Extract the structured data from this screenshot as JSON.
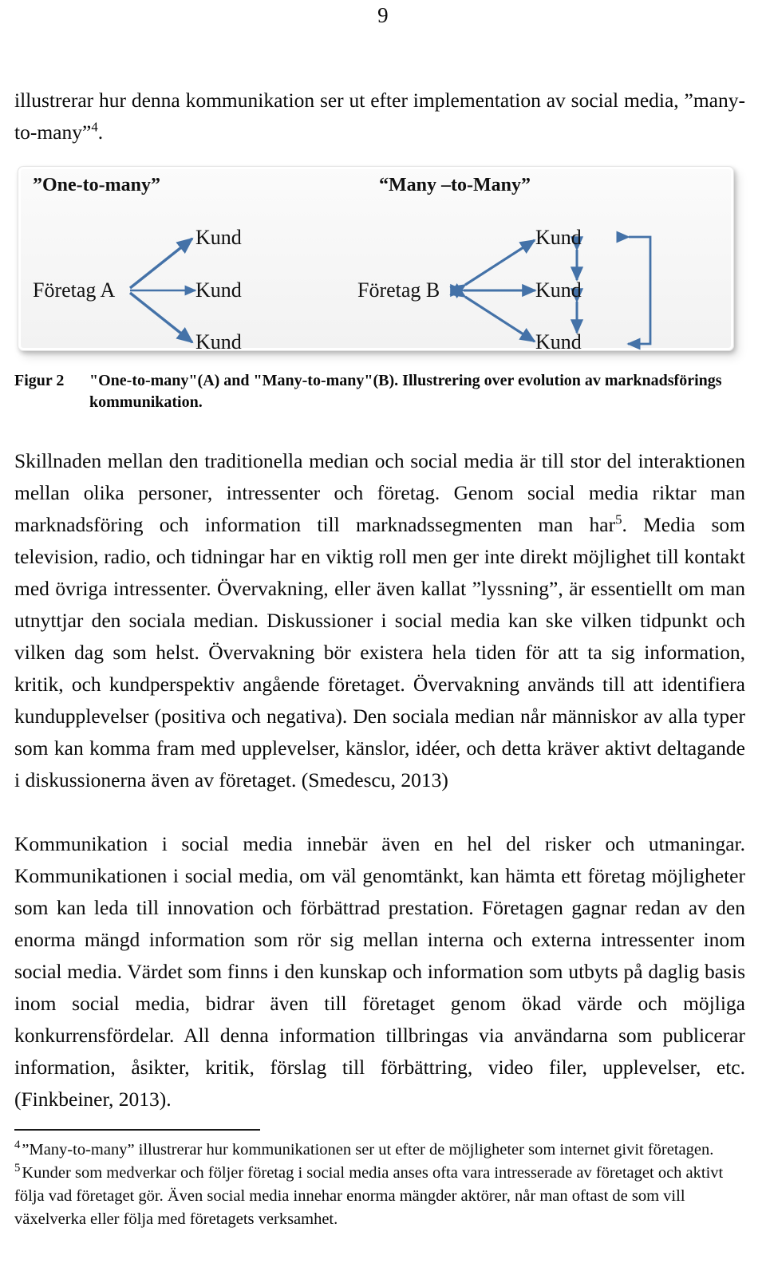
{
  "page": {
    "number": "9"
  },
  "body": {
    "paragraph_1": "illustrerar hur denna kommunikation ser ut efter implementation av social media, ”many-to-many”",
    "paragraph_1_footnote_ref": "4",
    "paragraph_1_tail": ".",
    "paragraph_2_a": "Skillnaden mellan den traditionella median och social media är till stor del interaktionen mellan olika personer, intressenter och företag. Genom social media riktar man marknadsföring och information till marknadssegmenten man har",
    "paragraph_2_footnote_ref": "5",
    "paragraph_2_b": ". Media som television, radio, och tidningar har en viktig roll men ger inte direkt möjlighet till kontakt med övriga intressenter. Övervakning, eller även kallat ”lyssning”, är essentiellt om man utnyttjar den sociala median. Diskussioner i social media kan ske vilken tidpunkt och vilken dag som helst. Övervakning bör existera hela tiden för att ta sig information, kritik, och kundperspektiv angående företaget. Övervakning används till att identifiera kundupplevelser (positiva och negativa). Den sociala median når människor av alla typer som kan komma fram med upplevelser, känslor, idéer, och detta kräver aktivt deltagande i diskussionerna även av företaget. (Smedescu, 2013)",
    "paragraph_3": "Kommunikation i social media innebär även en hel del risker och utmaningar. Kommunikationen i social media, om väl genomtänkt, kan hämta ett företag möjligheter som kan leda till innovation och förbättrad prestation. Företagen gagnar redan av den enorma mängd information som rör sig mellan interna och externa intressenter inom social media. Värdet som finns i den kunskap och information som utbyts på daglig basis inom social media, bidrar även till företaget genom ökad värde och möjliga konkurrensfördelar. All denna information tillbringas via användarna som publicerar information, åsikter, kritik, förslag till förbättring, video filer, upplevelser, etc. (Finkbeiner, 2013)."
  },
  "figure": {
    "left_title": "”One-to-many”",
    "right_title": "“Many –to-Many”",
    "left_hub": "Företag A",
    "right_hub": "Företag B",
    "left_nodes": [
      "Kund",
      "Kund",
      "Kund"
    ],
    "right_nodes": [
      "Kund",
      "Kund",
      "Kund"
    ],
    "arrow_color": "#4472A8",
    "caption_label": "Figur 2",
    "caption_text": "\"One-to-many\"(A) and \"Many-to-many\"(B). Illustrering over evolution av marknadsförings kommunikation."
  },
  "footnotes": [
    {
      "marker": "4",
      "text": "”Many-to-many” illustrerar hur kommunikationen ser ut efter de möjligheter som internet givit företagen."
    },
    {
      "marker": "5",
      "text": "Kunder som medverkar och följer företag i social media anses ofta vara intresserade av företaget och aktivt följa vad företaget gör. Även social media innehar enorma mängder aktörer, når man oftast de som vill växelverka eller följa med företagets verksamhet."
    }
  ]
}
